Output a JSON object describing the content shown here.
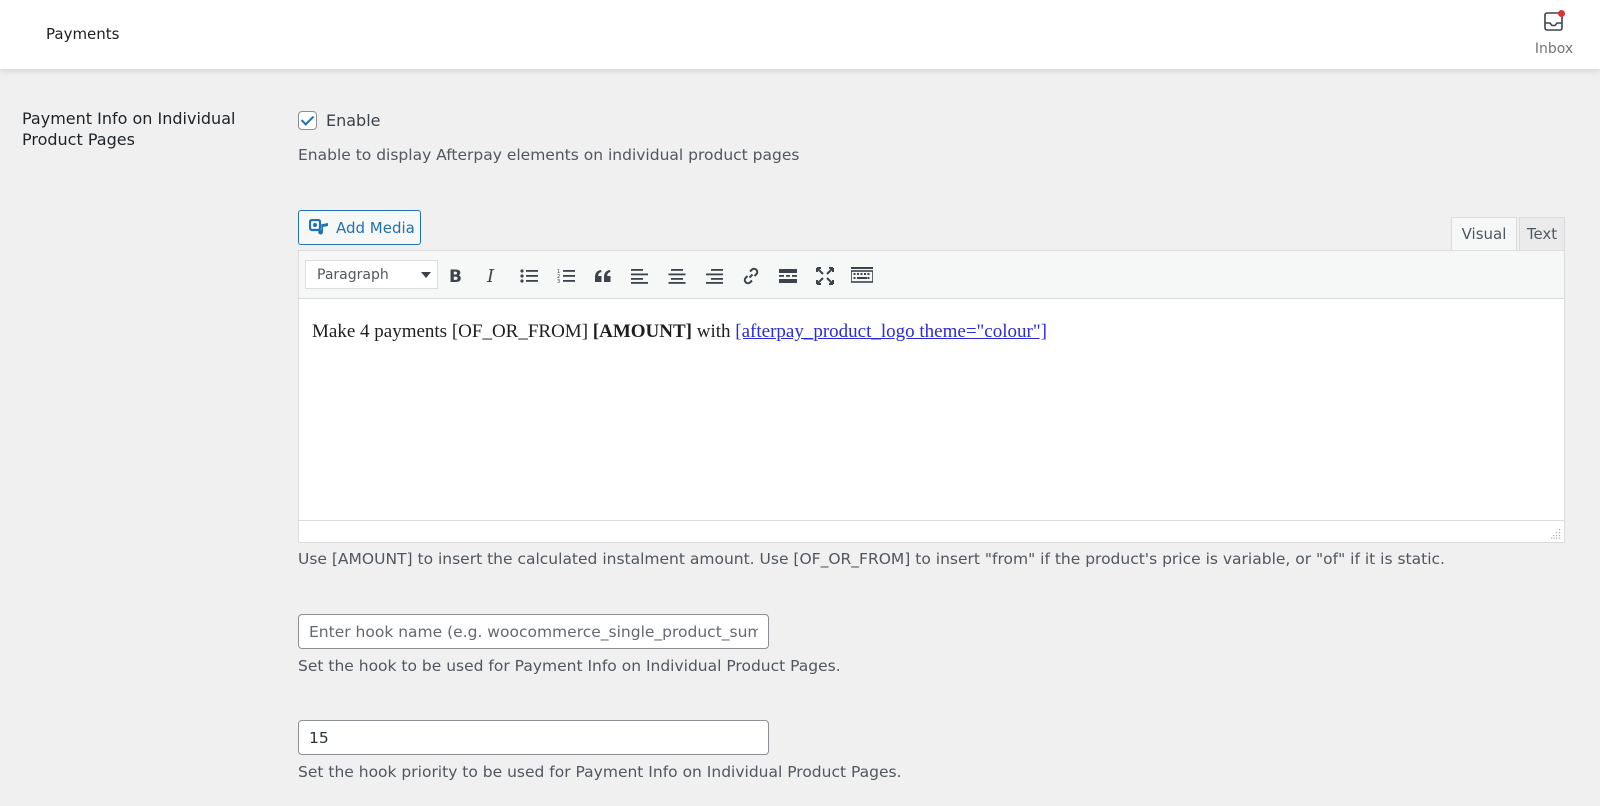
{
  "header": {
    "title": "Payments",
    "inbox_label": "Inbox"
  },
  "setting": {
    "label": "Payment Info on Individual Product Pages",
    "enable_label": "Enable",
    "enable_checked": true,
    "enable_description": "Enable to display Afterpay elements on individual product pages"
  },
  "editor": {
    "add_media_label": "Add Media",
    "tabs": {
      "visual": "Visual",
      "text": "Text",
      "active": "Visual"
    },
    "format_select": "Paragraph",
    "toolbar_icons": [
      "bold-icon",
      "italic-icon",
      "bullet-list-icon",
      "numbered-list-icon",
      "blockquote-icon",
      "align-left-icon",
      "align-center-icon",
      "align-right-icon",
      "link-icon",
      "read-more-icon",
      "fullscreen-icon",
      "toolbar-toggle-icon"
    ],
    "content": {
      "part1": "Make 4 payments [OF_OR_FROM] ",
      "bold": "[AMOUNT]",
      "part2": " with ",
      "shortcode": "[afterpay_product_logo theme=\"colour\"]"
    },
    "help": "Use [AMOUNT] to insert the calculated instalment amount. Use [OF_OR_FROM] to insert \"from\" if the product's price is variable, or \"of\" if it is static."
  },
  "hook": {
    "placeholder": "Enter hook name (e.g. woocommerce_single_product_summary)",
    "value": "",
    "description": "Set the hook to be used for Payment Info on Individual Product Pages."
  },
  "priority": {
    "value": "15",
    "description": "Set the hook priority to be used for Payment Info on Individual Product Pages."
  },
  "colors": {
    "accent": "#2271b1",
    "notification_dot": "#d63638",
    "background": "#f0f0f1"
  }
}
